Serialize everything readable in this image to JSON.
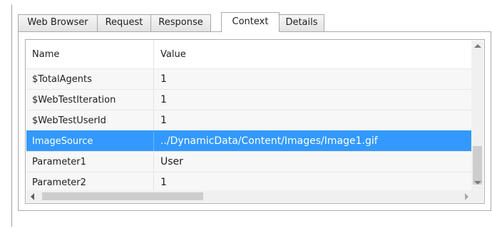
{
  "tabs": [
    {
      "label": "Web Browser",
      "active": false
    },
    {
      "label": "Request",
      "active": false
    },
    {
      "label": "Response",
      "active": false
    },
    {
      "label": "Context",
      "active": true
    },
    {
      "label": "Details",
      "active": false
    }
  ],
  "grid": {
    "columns": [
      "Name",
      "Value"
    ],
    "rows": [
      {
        "name": "$TotalAgents",
        "value": "1"
      },
      {
        "name": "$WebTestIteration",
        "value": "1"
      },
      {
        "name": "$WebTestUserId",
        "value": "1"
      },
      {
        "name": "ImageSource",
        "value": "../DynamicData/Content/Images/Image1.gif",
        "selected": true
      },
      {
        "name": "Parameter1",
        "value": "User"
      },
      {
        "name": "Parameter2",
        "value": "1"
      }
    ]
  },
  "colors": {
    "selection": "#3399ff",
    "selection_text": "#ffffff"
  },
  "icons": {
    "scroll_up": "chevron-up-icon",
    "scroll_down": "chevron-down-icon",
    "scroll_left": "chevron-left-icon",
    "scroll_right": "chevron-right-icon"
  }
}
